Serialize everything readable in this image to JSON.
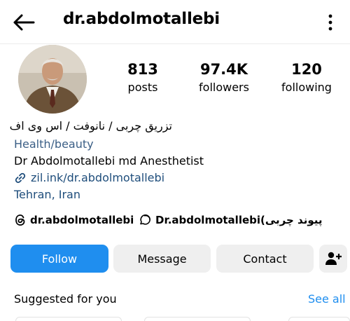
{
  "header": {
    "username": "dr.abdolmotallebi",
    "back_icon": "arrow-left-icon",
    "more_icon": "vertical-dots-icon"
  },
  "stats": {
    "posts": {
      "count": "813",
      "label": "posts"
    },
    "followers": {
      "count": "97.4K",
      "label": "followers"
    },
    "following": {
      "count": "120",
      "label": "following"
    }
  },
  "bio": {
    "tagline_fa": "تزریق چربی / نانوفت / اس وی اف",
    "category": "Health/beauty",
    "name_line": "Dr Abdolmotallebi md Anesthetist",
    "link": "zil.ink/dr.abdolmotallebi",
    "location": "Tehran, Iran"
  },
  "badges": {
    "threads": "dr.abdolmotallebi",
    "tiktok": "Dr.abdolmotallebi(پیوند چربی"
  },
  "buttons": {
    "follow": "Follow",
    "message": "Message",
    "contact": "Contact",
    "add_user_icon": "add-user-icon"
  },
  "suggested": {
    "title": "Suggested for you",
    "see_all": "See all"
  },
  "colors": {
    "accent": "#1f8eef",
    "link": "#1e4d7b",
    "button_bg": "#efefef"
  }
}
